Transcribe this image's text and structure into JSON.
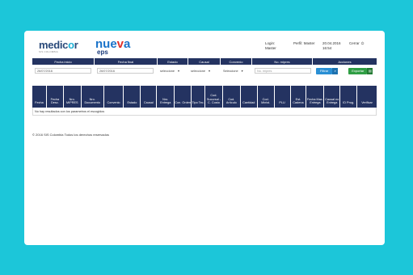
{
  "header": {
    "logo_left": {
      "text_a": "medic",
      "text_o": "o",
      "text_b": "r",
      "subtitle": "SIS COLOMBIA"
    },
    "logo_right": {
      "line1_a": "nue",
      "line1_v": "v",
      "line1_b": "a",
      "line2": "eps"
    },
    "login_label": "Login:",
    "login_value": "Master",
    "perfil_label": "Perfil: Master",
    "date": "20.04.2016",
    "time": "16:54",
    "logout_label": "Cerrar"
  },
  "filters": {
    "headers": [
      "Fecha inicio",
      "Fecha final",
      "Estado",
      "Causal",
      "Convenio",
      "No. mipres",
      "Acciones"
    ],
    "fecha_inicio": "26/07/2016",
    "fecha_final": "26/07/2016",
    "estado": "seleccione",
    "causal": "seleccione",
    "convenio": "Seleccione",
    "mipres_placeholder": "No. mipres",
    "filter_button": "Filtrar",
    "export_button": "Exportar"
  },
  "grid": {
    "columns": [
      "Fecha",
      "Fecha Desc.",
      "Nro. MIPRES",
      "Nro. Documento",
      "Convenio",
      "Estado",
      "Causal",
      "Nro. Entrega",
      "Con. Orden",
      "Tipo Tec.",
      "Cod. Sucursal - C. Costo",
      "Cod. Artículo",
      "Cantidad",
      "Cod. Minist.",
      "PLU",
      "Est. Cadena",
      "Fecha Max. Entrega",
      "Causal no Entrega",
      "ID Prog.",
      "Verificar"
    ],
    "empty_message": "No hay resultados con los parametros el escogidos"
  },
  "footer": "© 2016 SIS Colombia Todos los derechos reservados"
}
